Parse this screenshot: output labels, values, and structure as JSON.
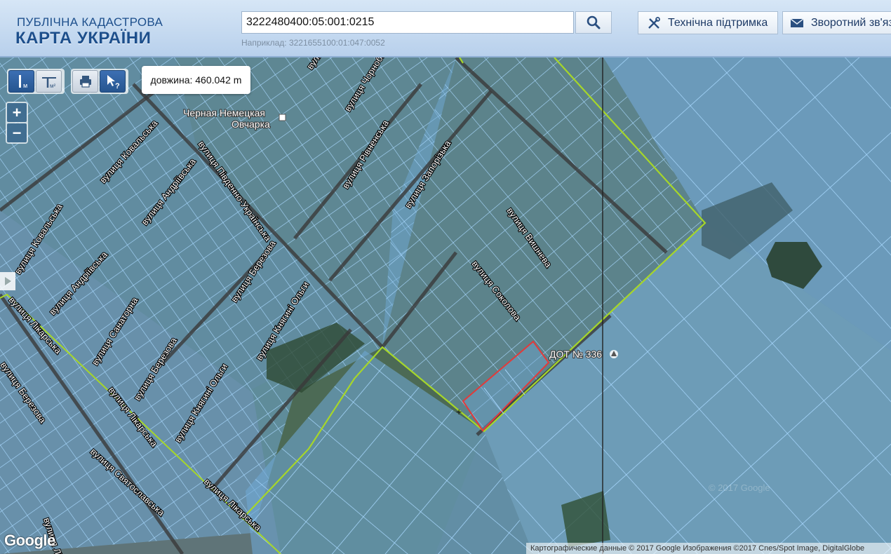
{
  "header": {
    "logo_line1": "ПУБЛІЧНА КАДАСТРОВА",
    "logo_line2": "КАРТА УКРАЇНИ",
    "search_value": "3222480400:05:001:0215",
    "example_text": "Наприклад: 3221655100:01:047:0052",
    "support_label": "Технічна підтримка",
    "feedback_label": "Зворотний зв'язок",
    "search_icon": "magnifier-icon",
    "support_icon": "tools-icon",
    "feedback_icon": "envelope-icon"
  },
  "toolbar": {
    "measure_length_sub": "м",
    "measure_area_sub": "м²",
    "print_icon": "printer-icon",
    "info_icon": "cursor-question-icon",
    "measure_result": "довжина: 460.042 m"
  },
  "zoom": {
    "in": "+",
    "out": "−"
  },
  "map": {
    "streets": [
      "вулиця Коваль",
      "вулиця Чорнобиль",
      "вулиця Ковальська",
      "вулиця Південно-Українська",
      "вулиця Рівненська",
      "вулиця Запорізька",
      "вулиця Андріївська",
      "вулиця Ковальська",
      "вулиця Березова",
      "вулиця Вишнева",
      "вулиця Андріївська",
      "вулиця Княгині Ольги",
      "вулиця Соколова",
      "вулиця Санаторна",
      "вулиця Лікарська",
      "вулиця Березова",
      "вулиця Княгині Ольги",
      "вулиця Лікарська",
      "вулиця Святославська",
      "вулиця Лікарська",
      "вулиця Лі",
      "вулиця Березова"
    ],
    "poi_business": "Черная Немецкая Овчарка",
    "poi_business_line2": "Овчарка",
    "poi_building": "ДОТ № 336",
    "watermark": "© 2017 Google"
  },
  "footer": {
    "google": "Google",
    "attribution": "Картографические данные © 2017 Google Изображения ©2017 Cnes/Spot Image, DigitalGlobe"
  },
  "colors": {
    "parcel_fill": "#6ea7d2",
    "parcel_stroke": "#9bd2ff",
    "boundary": "#a6d62a",
    "selected": "#e23a3a"
  }
}
